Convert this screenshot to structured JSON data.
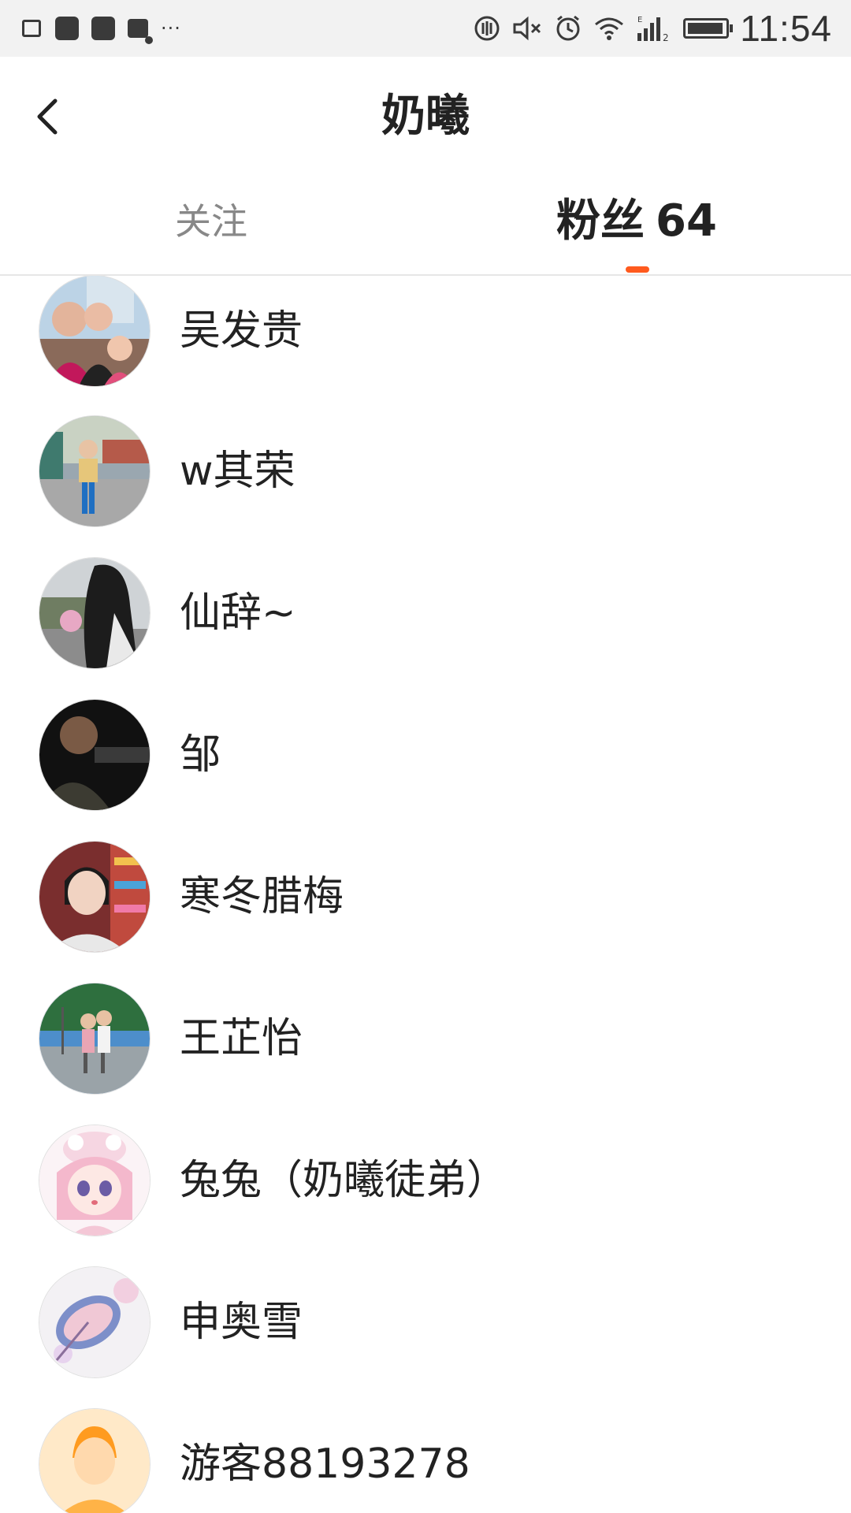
{
  "status_bar": {
    "time": "11:54",
    "dots": "···",
    "icons": [
      "image-icon",
      "app-icon",
      "app-icon",
      "chat-icon",
      "vibrate-icon",
      "mute-icon",
      "alarm-icon",
      "wifi-icon",
      "signal-icon",
      "battery-icon"
    ],
    "battery_level": 0.85
  },
  "header": {
    "title": "奶曦",
    "back_icon": "chevron-left-icon"
  },
  "tabs": {
    "follow_label": "关注",
    "fans_label": "粉丝",
    "fans_count": "64",
    "active": "fans",
    "accent_color": "#ff5a1e"
  },
  "fans": [
    {
      "name": "吴发贵",
      "avatar": "photo-group"
    },
    {
      "name": "w其荣",
      "avatar": "photo-child"
    },
    {
      "name": "仙辞~",
      "avatar": "photo-girl"
    },
    {
      "name": "邹",
      "avatar": "photo-dark"
    },
    {
      "name": "寒冬腊梅",
      "avatar": "photo-girl-store"
    },
    {
      "name": "王芷怡",
      "avatar": "photo-kids-outdoor"
    },
    {
      "name": "兔兔（奶曦徒弟）",
      "avatar": "anime-girl"
    },
    {
      "name": "申奥雪",
      "avatar": "umbrella-art"
    },
    {
      "name": "游客88193278",
      "avatar": "default-avatar"
    }
  ]
}
